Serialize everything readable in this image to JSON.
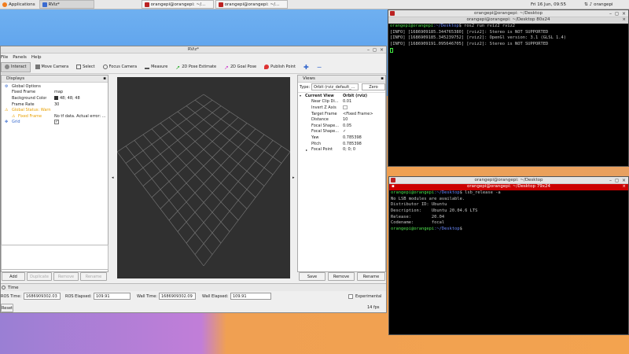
{
  "taskbar": {
    "applications": "Applications",
    "tasks": [
      {
        "label": "RViz*",
        "active": true
      },
      {
        "label": "orangepi@orangepi: ~/...",
        "active": false
      },
      {
        "label": "orangepi@orangepi: ~/...",
        "active": false
      }
    ],
    "clock": "Fri 16 Jun, 09:55",
    "user": "orangepi"
  },
  "rviz": {
    "title": "RViz*",
    "menu": [
      "File",
      "Panels",
      "Help"
    ],
    "tools": [
      {
        "label": "Interact",
        "icon": "interact-icon"
      },
      {
        "label": "Move Camera",
        "icon": "move-camera-icon"
      },
      {
        "label": "Select",
        "icon": "select-icon"
      },
      {
        "label": "Focus Camera",
        "icon": "focus-camera-icon"
      },
      {
        "label": "Measure",
        "icon": "measure-icon"
      },
      {
        "label": "2D Pose Estimate",
        "icon": "pose-estimate-icon"
      },
      {
        "label": "2D Goal Pose",
        "icon": "goal-pose-icon"
      },
      {
        "label": "Publish Point",
        "icon": "publish-point-icon"
      }
    ],
    "displays": {
      "title": "Displays",
      "rows": [
        {
          "key": "Global Options",
          "val": ""
        },
        {
          "key": "Fixed Frame",
          "val": "map"
        },
        {
          "key": "Background Color",
          "val": "48; 48; 48"
        },
        {
          "key": "Frame Rate",
          "val": "30"
        },
        {
          "key": "Global Status: Warn",
          "val": ""
        },
        {
          "key": "Fixed Frame",
          "val": "No tf data.  Actual error: ..."
        },
        {
          "key": "Grid",
          "val": ""
        }
      ],
      "buttons": [
        "Add",
        "Duplicate",
        "Remove",
        "Rename"
      ]
    },
    "views": {
      "title": "Views",
      "type_label": "Type:",
      "type_value": "Orbit (rviz_default_...",
      "zero": "Zero",
      "rows": [
        {
          "key": "Current View",
          "val": "Orbit (rviz)"
        },
        {
          "key": "Near Clip Di...",
          "val": "0.01"
        },
        {
          "key": "Invert Z Axis",
          "val": ""
        },
        {
          "key": "Target Frame",
          "val": "<Fixed Frame>"
        },
        {
          "key": "Distance",
          "val": "10"
        },
        {
          "key": "Focal Shape...",
          "val": "0.05"
        },
        {
          "key": "Focal Shape...",
          "val": "✓"
        },
        {
          "key": "Yaw",
          "val": "0.785398"
        },
        {
          "key": "Pitch",
          "val": "0.785398"
        },
        {
          "key": "Focal Point",
          "val": "0; 0; 0"
        }
      ],
      "buttons": [
        "Save",
        "Remove",
        "Rename"
      ]
    },
    "time": {
      "title": "Time",
      "ros_time_label": "ROS Time:",
      "ros_time": "1686909302.03",
      "ros_elapsed_label": "ROS Elapsed:",
      "ros_elapsed": "109.91",
      "wall_time_label": "Wall Time:",
      "wall_time": "1686909302.09",
      "wall_elapsed_label": "Wall Elapsed:",
      "wall_elapsed": "109.91",
      "experimental": "Experimental",
      "reset": "Reset",
      "fps": "14 fps"
    }
  },
  "term1": {
    "title": "orangepi@orangepi: ~/Desktop",
    "subtitle": "orangepi@orangepi: ~/Desktop 80x24",
    "prompt_user": "orangepi@orangepi",
    "prompt_path": ":~/Desktop",
    "command": "$ ros2 run rviz2 rviz2",
    "lines": [
      "[INFO] [1686909185.344765380] [rviz2]: Stereo is NOT SUPPORTED",
      "[INFO] [1686909185.345239752] [rviz2]: OpenGl version: 3.1 (GLSL 1.4)",
      "[INFO] [1686909191.095646705] [rviz2]: Stereo is NOT SUPPORTED"
    ]
  },
  "term2": {
    "title": "orangepi@orangepi: ~/Desktop",
    "subtitle": "orangepi@orangepi: ~/Desktop 79x24",
    "prompt_user": "orangepi@orangepi",
    "prompt_path": ":~/Desktop",
    "command": "$ lsb_release -a",
    "lines": [
      "No LSB modules are available.",
      "Distributor ID: Ubuntu",
      "Description:    Ubuntu 20.04.6 LTS",
      "Release:        20.04",
      "Codename:       focal"
    ],
    "prompt_end": "$"
  },
  "colors": {
    "accent": "#3b7dd8",
    "term_red": "#cc0000",
    "warn": "#e8a000"
  }
}
